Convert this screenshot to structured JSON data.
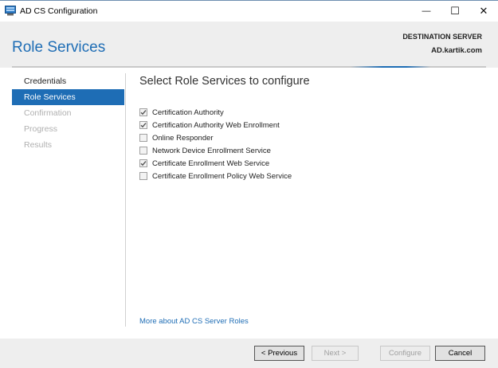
{
  "window": {
    "title": "AD CS Configuration",
    "minimize_glyph": "—",
    "maximize_glyph": "☐",
    "close_glyph": "✕"
  },
  "header": {
    "page_title": "Role Services",
    "destination_label": "DESTINATION SERVER",
    "destination_value": "AD.kartik.com"
  },
  "nav": {
    "items": [
      {
        "label": "Credentials",
        "state": "normal"
      },
      {
        "label": "Role Services",
        "state": "active"
      },
      {
        "label": "Confirmation",
        "state": "disabled"
      },
      {
        "label": "Progress",
        "state": "disabled"
      },
      {
        "label": "Results",
        "state": "disabled"
      }
    ]
  },
  "main": {
    "section_title": "Select Role Services to configure",
    "roles": [
      {
        "label": "Certification Authority",
        "checked": true
      },
      {
        "label": "Certification Authority Web Enrollment",
        "checked": true
      },
      {
        "label": "Online Responder",
        "checked": false
      },
      {
        "label": "Network Device Enrollment Service",
        "checked": false
      },
      {
        "label": "Certificate Enrollment Web Service",
        "checked": true
      },
      {
        "label": "Certificate Enrollment Policy Web Service",
        "checked": false
      }
    ],
    "more_link": "More about AD CS Server Roles"
  },
  "footer": {
    "previous_label": "< Previous",
    "next_label": "Next >",
    "configure_label": "Configure",
    "cancel_label": "Cancel"
  },
  "colors": {
    "accent": "#1e6db5",
    "header_bg": "#eeeeee",
    "disabled_text": "#b0b0b0"
  }
}
